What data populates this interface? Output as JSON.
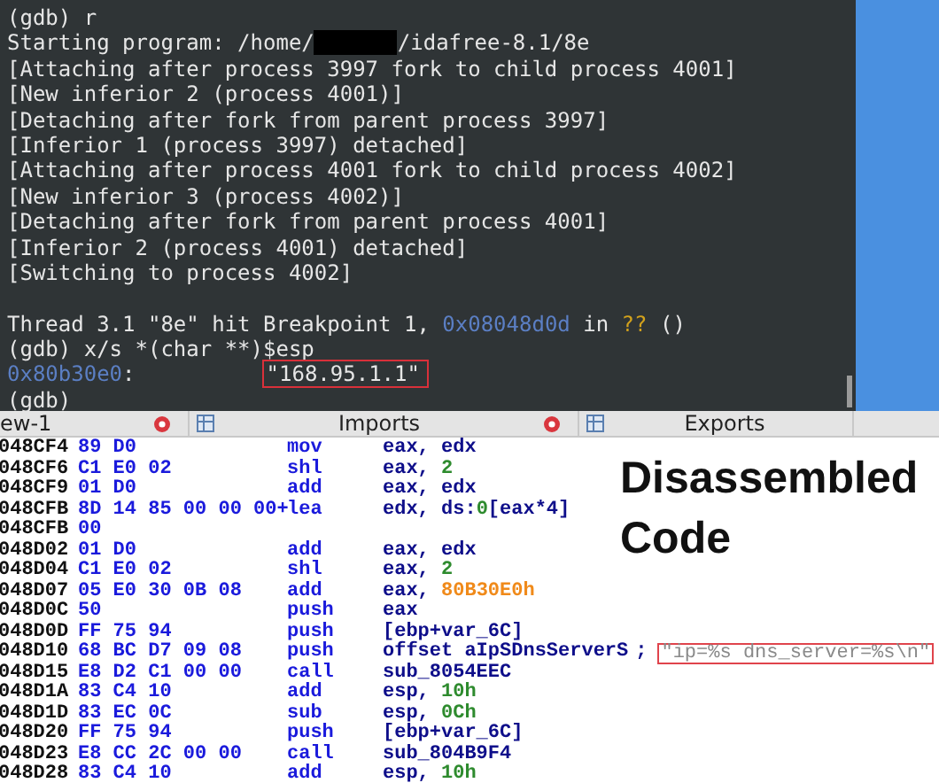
{
  "terminal": {
    "lines": [
      {
        "segments": [
          {
            "t": "(gdb) r",
            "kind": "plain"
          }
        ]
      },
      {
        "segments": [
          {
            "t": "Starting program: /home/",
            "kind": "plain"
          },
          {
            "kind": "redacted"
          },
          {
            "t": "/idafree-8.1/8e",
            "kind": "plain"
          }
        ]
      },
      {
        "segments": [
          {
            "t": "[Attaching after process 3997 fork to child process 4001]",
            "kind": "plain"
          }
        ]
      },
      {
        "segments": [
          {
            "t": "[New inferior 2 (process 4001)]",
            "kind": "plain"
          }
        ]
      },
      {
        "segments": [
          {
            "t": "[Detaching after fork from parent process 3997]",
            "kind": "plain"
          }
        ]
      },
      {
        "segments": [
          {
            "t": "[Inferior 1 (process 3997) detached]",
            "kind": "plain"
          }
        ]
      },
      {
        "segments": [
          {
            "t": "[Attaching after process 4001 fork to child process 4002]",
            "kind": "plain"
          }
        ]
      },
      {
        "segments": [
          {
            "t": "[New inferior 3 (process 4002)]",
            "kind": "plain"
          }
        ]
      },
      {
        "segments": [
          {
            "t": "[Detaching after fork from parent process 4001]",
            "kind": "plain"
          }
        ]
      },
      {
        "segments": [
          {
            "t": "[Inferior 2 (process 4001) detached]",
            "kind": "plain"
          }
        ]
      },
      {
        "segments": [
          {
            "t": "[Switching to process 4002]",
            "kind": "plain"
          }
        ]
      },
      {
        "gap_before": true,
        "segments": [
          {
            "t": "Thread 3.1 \"8e\" hit Breakpoint 1, ",
            "kind": "plain"
          },
          {
            "t": "0x08048d0d",
            "kind": "addr"
          },
          {
            "t": " in ",
            "kind": "plain"
          },
          {
            "t": "??",
            "kind": "warn"
          },
          {
            "t": " ()",
            "kind": "plain"
          }
        ]
      },
      {
        "segments": [
          {
            "t": "(gdb) x/s *(char **)$esp",
            "kind": "plain"
          }
        ]
      },
      {
        "segments": [
          {
            "t": "0x80b30e0",
            "kind": "addr"
          },
          {
            "t": ":",
            "kind": "plain"
          },
          {
            "t": "\"168.95.1.1\"",
            "kind": "boxed"
          }
        ]
      },
      {
        "segments": [
          {
            "t": "(gdb)",
            "kind": "plain"
          }
        ]
      }
    ]
  },
  "tabs": [
    {
      "label": "ew-1",
      "icon": false,
      "closable": true
    },
    {
      "label": "Imports",
      "icon": true,
      "closable": true
    },
    {
      "label": "Exports",
      "icon": true,
      "closable": false
    }
  ],
  "disassembly": {
    "rows": [
      {
        "address": "048CF4",
        "bytes": "89 D0",
        "mnemonic": "mov",
        "operand": [
          {
            "t": "eax, edx",
            "kind": "reg"
          }
        ]
      },
      {
        "address": "048CF6",
        "bytes": "C1 E0 02",
        "mnemonic": "shl",
        "operand": [
          {
            "t": "eax, ",
            "kind": "reg"
          },
          {
            "t": "2",
            "kind": "num"
          }
        ]
      },
      {
        "address": "048CF9",
        "bytes": "01 D0",
        "mnemonic": "add",
        "operand": [
          {
            "t": "eax, edx",
            "kind": "reg"
          }
        ]
      },
      {
        "address": "048CFB",
        "bytes": "8D 14 85 00 00 00+",
        "mnemonic": "lea",
        "operand": [
          {
            "t": "edx, ds:",
            "kind": "reg"
          },
          {
            "t": "0",
            "kind": "num"
          },
          {
            "t": "[eax*4]",
            "kind": "reg"
          }
        ]
      },
      {
        "address": "048CFB",
        "bytes": "00"
      },
      {
        "address": "048D02",
        "bytes": "01 D0",
        "mnemonic": "add",
        "operand": [
          {
            "t": "eax, edx",
            "kind": "reg"
          }
        ]
      },
      {
        "address": "048D04",
        "bytes": "C1 E0 02",
        "mnemonic": "shl",
        "operand": [
          {
            "t": "eax, ",
            "kind": "reg"
          },
          {
            "t": "2",
            "kind": "num"
          }
        ]
      },
      {
        "address": "048D07",
        "bytes": "05 E0 30 0B 08",
        "mnemonic": "add",
        "operand": [
          {
            "t": "eax, ",
            "kind": "reg"
          },
          {
            "t": "80B30E0h",
            "kind": "addr"
          }
        ]
      },
      {
        "address": "048D0C",
        "bytes": "50",
        "mnemonic": "push",
        "operand": [
          {
            "t": "eax",
            "kind": "reg"
          }
        ]
      },
      {
        "address": "048D0D",
        "bytes": "FF 75 94",
        "mnemonic": "push",
        "operand": [
          {
            "t": "[ebp+var_6C]",
            "kind": "reg"
          }
        ]
      },
      {
        "address": "048D10",
        "bytes": "68 BC D7 09 08",
        "mnemonic": "push",
        "operand": [
          {
            "t": "offset aIpSDnsServerS",
            "kind": "reg"
          }
        ],
        "separator": ";",
        "comment": "\"ip=%s dns_server=%s\\n\""
      },
      {
        "address": "048D15",
        "bytes": "E8 D2 C1 00 00",
        "mnemonic": "call",
        "operand": [
          {
            "t": "sub_8054EEC",
            "kind": "reg"
          }
        ]
      },
      {
        "address": "048D1A",
        "bytes": "83 C4 10",
        "mnemonic": "add",
        "operand": [
          {
            "t": "esp, ",
            "kind": "reg"
          },
          {
            "t": "10h",
            "kind": "num"
          }
        ]
      },
      {
        "address": "048D1D",
        "bytes": "83 EC 0C",
        "mnemonic": "sub",
        "operand": [
          {
            "t": "esp, ",
            "kind": "reg"
          },
          {
            "t": "0Ch",
            "kind": "num"
          }
        ]
      },
      {
        "address": "048D20",
        "bytes": "FF 75 94",
        "mnemonic": "push",
        "operand": [
          {
            "t": "[ebp+var_6C]",
            "kind": "reg"
          }
        ]
      },
      {
        "address": "048D23",
        "bytes": "E8 CC 2C 00 00",
        "mnemonic": "call",
        "operand": [
          {
            "t": "sub_804B9F4",
            "kind": "reg"
          }
        ]
      },
      {
        "address": "048D28",
        "bytes": "83 C4 10",
        "mnemonic": "add",
        "operand": [
          {
            "t": "esp, ",
            "kind": "reg"
          },
          {
            "t": "10h",
            "kind": "num"
          }
        ]
      }
    ]
  },
  "caption": "Disassembled Code"
}
